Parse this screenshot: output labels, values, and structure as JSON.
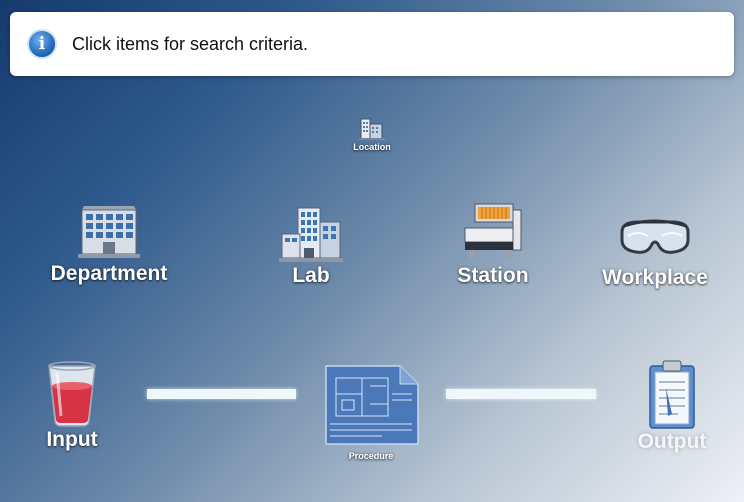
{
  "info": {
    "icon": "info-icon",
    "glyph": "i",
    "message": "Click items for search criteria."
  },
  "location": {
    "label": "Location",
    "icon": "building-cluster-icon"
  },
  "department": {
    "label": "Department",
    "icon": "office-building-icon"
  },
  "lab": {
    "label": "Lab",
    "icon": "lab-building-icon"
  },
  "station": {
    "label": "Station",
    "icon": "workstation-machine-icon"
  },
  "workplace": {
    "label": "Workplace",
    "icon": "safety-goggles-icon"
  },
  "input": {
    "label": "Input",
    "icon": "glass-icon"
  },
  "procedure": {
    "label": "Procedure",
    "icon": "blueprint-icon"
  },
  "output": {
    "label": "Output",
    "icon": "clipboard-icon"
  },
  "colors": {
    "background_dark": "#163a6e",
    "background_light": "#eef1f5",
    "connector": "#eef8fb"
  }
}
